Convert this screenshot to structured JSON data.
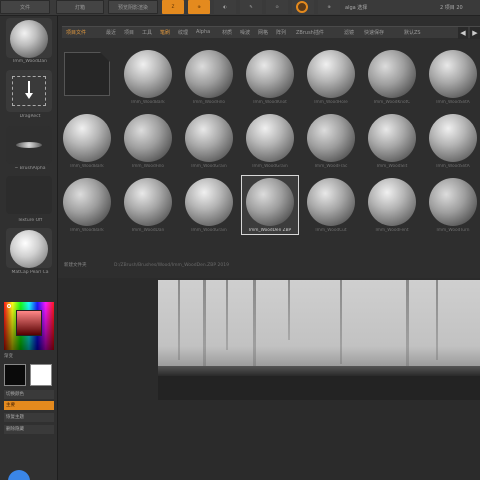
{
  "topbar": {
    "buttons": [
      "文件",
      "灯箱",
      "预览阴影渲染"
    ],
    "orange_buttons": [
      "Z",
      "⊕"
    ],
    "gray_buttons": [
      "◐",
      "✎",
      "⊙",
      "≡",
      "⊕"
    ],
    "status_text": "2 项目 20",
    "status_text_small": "alga 选择"
  },
  "left_panel": {
    "brush_label": "Imm_WoodDan",
    "stroke_label": "DragRect",
    "alpha_label": "~ BrushAlpha",
    "texture_label": "Texture Off",
    "material_label": "MatCap Pearl Ca",
    "color_label": "渐变",
    "buttons": [
      "切换颜色",
      "主要",
      "恢复主题",
      "删除隐藏"
    ],
    "swatch_main": "#0a0a0a",
    "swatch_secondary": "#ffffff"
  },
  "library": {
    "tabs": [
      "项目文件",
      "最近",
      "项目",
      "工具",
      "笔刷",
      "纹理",
      "Alpha",
      "材质",
      "噪波",
      "网格",
      "阵列",
      "ZBrush插件",
      "滤镜",
      "快速保存",
      "默认ZS"
    ],
    "active_tab_index": 4,
    "items": [
      {
        "label": "",
        "type": "folder"
      },
      {
        "label": "Imm_WoodBark",
        "type": "sphere"
      },
      {
        "label": "Imm_WoodFillo",
        "type": "sphere"
      },
      {
        "label": "Imm_WoodKnot",
        "type": "sphere"
      },
      {
        "label": "Imm_WoodHole",
        "type": "sphere"
      },
      {
        "label": "Imm_WoodKnotC",
        "type": "sphere"
      },
      {
        "label": "Imm_WoodSlitA",
        "type": "sphere"
      },
      {
        "label": "Imm_WoodBark",
        "type": "sphere"
      },
      {
        "label": "Imm_WoodFillo",
        "type": "sphere"
      },
      {
        "label": "Imm_WoodGrain",
        "type": "sphere"
      },
      {
        "label": "Imm_WoodGrain",
        "type": "sphere"
      },
      {
        "label": "Imm_WoodFrac",
        "type": "sphere"
      },
      {
        "label": "Imm_WoodSlit",
        "type": "sphere"
      },
      {
        "label": "Imm_WoodSlitA",
        "type": "sphere"
      },
      {
        "label": "Imm_WoodBark",
        "type": "sphere"
      },
      {
        "label": "Imm_WoodDan",
        "type": "sphere"
      },
      {
        "label": "Imm_WoodGrain",
        "type": "sphere"
      },
      {
        "label": "Imm_WoodDen ZBP",
        "type": "sphere",
        "selected": true
      },
      {
        "label": "Imm_WoodCut",
        "type": "sphere"
      },
      {
        "label": "Imm_WoodFent",
        "type": "sphere"
      },
      {
        "label": "Imm_WoodTurn",
        "type": "sphere"
      }
    ],
    "footer_button": "新建文件夹",
    "footer_path": "D:/ZBrush/Brushes/Wood/Imm_WoodDen.ZBP 2019"
  }
}
